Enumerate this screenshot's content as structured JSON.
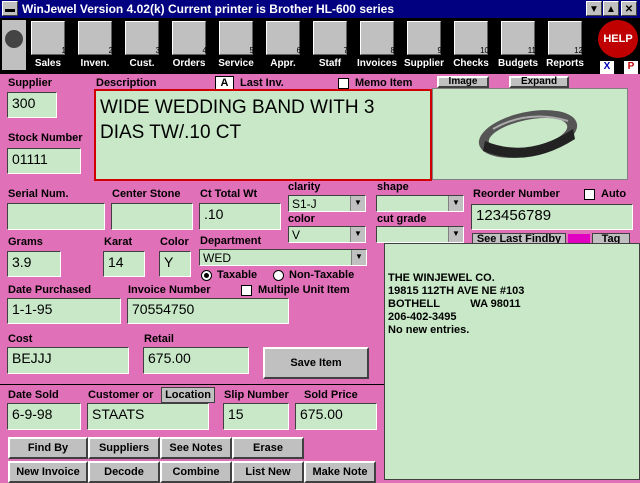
{
  "window": {
    "title": "WinJewel Version 4.02(k)   Current printer is Brother HL-600 series"
  },
  "toolbar": {
    "items": [
      {
        "label": "Sales",
        "num": "1"
      },
      {
        "label": "Inven.",
        "num": "2"
      },
      {
        "label": "Cust.",
        "num": "3"
      },
      {
        "label": "Orders",
        "num": "4"
      },
      {
        "label": "Service",
        "num": "5"
      },
      {
        "label": "Appr.",
        "num": "6"
      },
      {
        "label": "Staff",
        "num": "7"
      },
      {
        "label": "Invoices",
        "num": "8"
      },
      {
        "label": "Supplier",
        "num": "9"
      },
      {
        "label": "Checks",
        "num": "10"
      },
      {
        "label": "Budgets",
        "num": "11"
      },
      {
        "label": "Reports",
        "num": "12"
      }
    ],
    "help_label": "HELP",
    "x_label": "X",
    "p_label": "P"
  },
  "form": {
    "supplier_label": "Supplier",
    "supplier": "300",
    "description_label": "Description",
    "description_line1": "WIDE WEDDING BAND WITH 3",
    "description_line2": "DIAS TW/.10 CT",
    "a_label": "A",
    "last_inv_label": "Last Inv.",
    "memo_label": "Memo Item",
    "image_label": "Image",
    "expand_label": "Expand",
    "stock_label": "Stock Number",
    "stock": "01111",
    "serial_label": "Serial Num.",
    "serial": "",
    "center_label": "Center Stone",
    "center": "",
    "ct_label": "Ct Total Wt",
    "ct": ".10",
    "clarity_label": "clarity",
    "clarity": "S1-J",
    "color2_label": "color",
    "color2": "V",
    "shape_label": "shape",
    "shape": "",
    "cut_label": "cut grade",
    "cut": "",
    "reorder_label": "Reorder Number",
    "reorder": "123456789",
    "auto_label": "Auto",
    "grams_label": "Grams",
    "grams": "3.9",
    "karat_label": "Karat",
    "karat": "14",
    "color_label": "Color",
    "color": "Y",
    "dept_label": "Department",
    "dept": "WED",
    "taxable_label": "Taxable",
    "nontaxable_label": "Non-Taxable",
    "purchased_label": "Date Purchased",
    "purchased": "1-1-95",
    "invoice_label": "Invoice Number",
    "invoice": "70554750",
    "multi_label": "Multiple Unit Item",
    "cost_label": "Cost",
    "cost": "BEJJJ",
    "retail_label": "Retail",
    "retail": "675.00",
    "save_label": "Save Item",
    "see_last_label": "See Last Findby",
    "tag_label": "Tag",
    "memo_lines": [
      "THE WINJEWEL CO.",
      "19815 112TH AVE NE #103",
      "BOTHELL          WA 98011",
      "206-402-3495",
      "No new entries."
    ],
    "sold_label": "Date Sold",
    "sold": "6-9-98",
    "customer_label": "Customer or",
    "location_label": "Location",
    "customer": "STAATS",
    "slip_label": "Slip Number",
    "slip": "15",
    "soldprice_label": "Sold Price",
    "soldprice": "675.00"
  },
  "buttons": {
    "find_by": "Find By",
    "suppliers": "Suppliers",
    "see_notes": "See Notes",
    "erase": "Erase",
    "new_invoice": "New Invoice",
    "decode": "Decode",
    "combine": "Combine",
    "list_new": "List New",
    "make_note": "Make Note"
  },
  "colors": {
    "background": "#e070b8",
    "field": "#c8e8c8",
    "titlebar": "#000080",
    "toolbar": "#000000"
  }
}
